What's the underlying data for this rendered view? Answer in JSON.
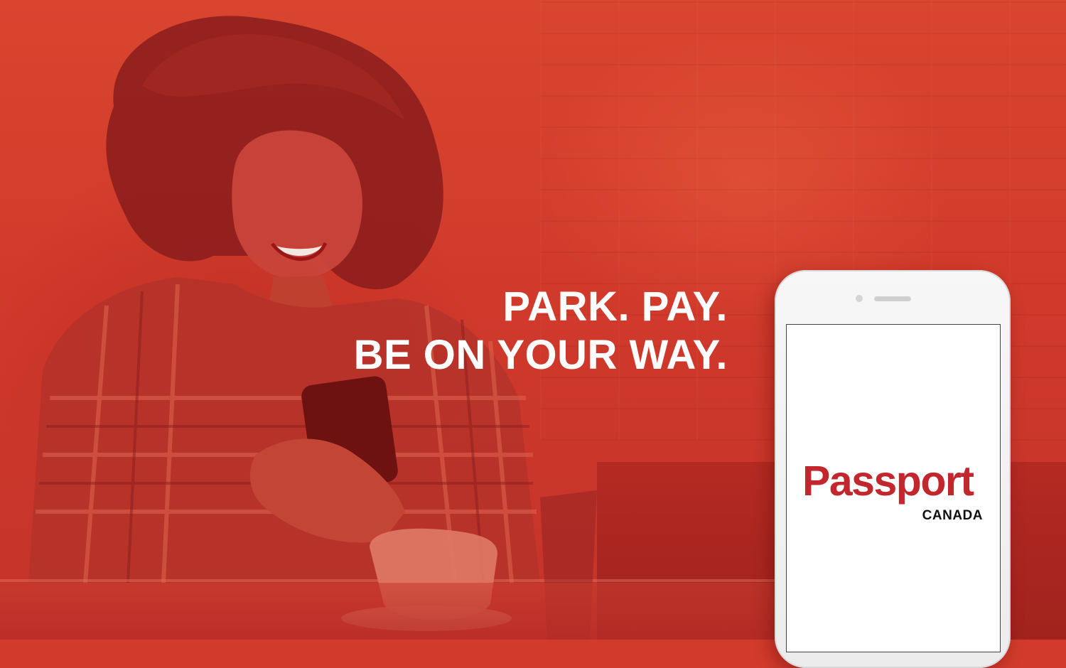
{
  "headline": {
    "line1": "PARK. PAY.",
    "line2": "BE ON YOUR WAY."
  },
  "phone": {
    "brand": "Passport",
    "region": "CANADA"
  },
  "colors": {
    "background_red": "#d23b2b",
    "brand_red": "#c1272d",
    "text_white": "#ffffff"
  },
  "icons": {
    "phone_camera": "camera-dot-icon",
    "phone_speaker": "speaker-slot-icon"
  }
}
